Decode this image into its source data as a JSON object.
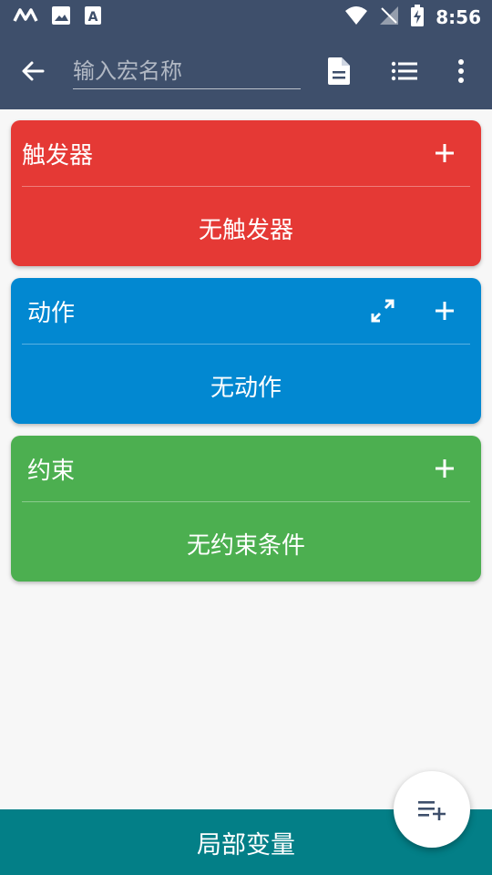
{
  "status_bar": {
    "time": "8:56",
    "left_icons": [
      "macrodroid-icon",
      "image-icon",
      "text-icon"
    ],
    "right_icons": [
      "wifi-icon",
      "no-signal-icon",
      "battery-charging-icon"
    ]
  },
  "app_bar": {
    "macro_name_placeholder": "输入宏名称",
    "macro_name_value": ""
  },
  "sections": {
    "triggers": {
      "title": "触发器",
      "empty_text": "无触发器",
      "color": "#e53935"
    },
    "actions": {
      "title": "动作",
      "empty_text": "无动作",
      "color": "#0288d1"
    },
    "constraints": {
      "title": "约束",
      "empty_text": "无约束条件",
      "color": "#4caf50"
    }
  },
  "bottom_bar": {
    "label": "局部变量",
    "color": "#037f87"
  },
  "colors": {
    "app_bar": "#3e4f6b",
    "background": "#f7f7f7"
  }
}
